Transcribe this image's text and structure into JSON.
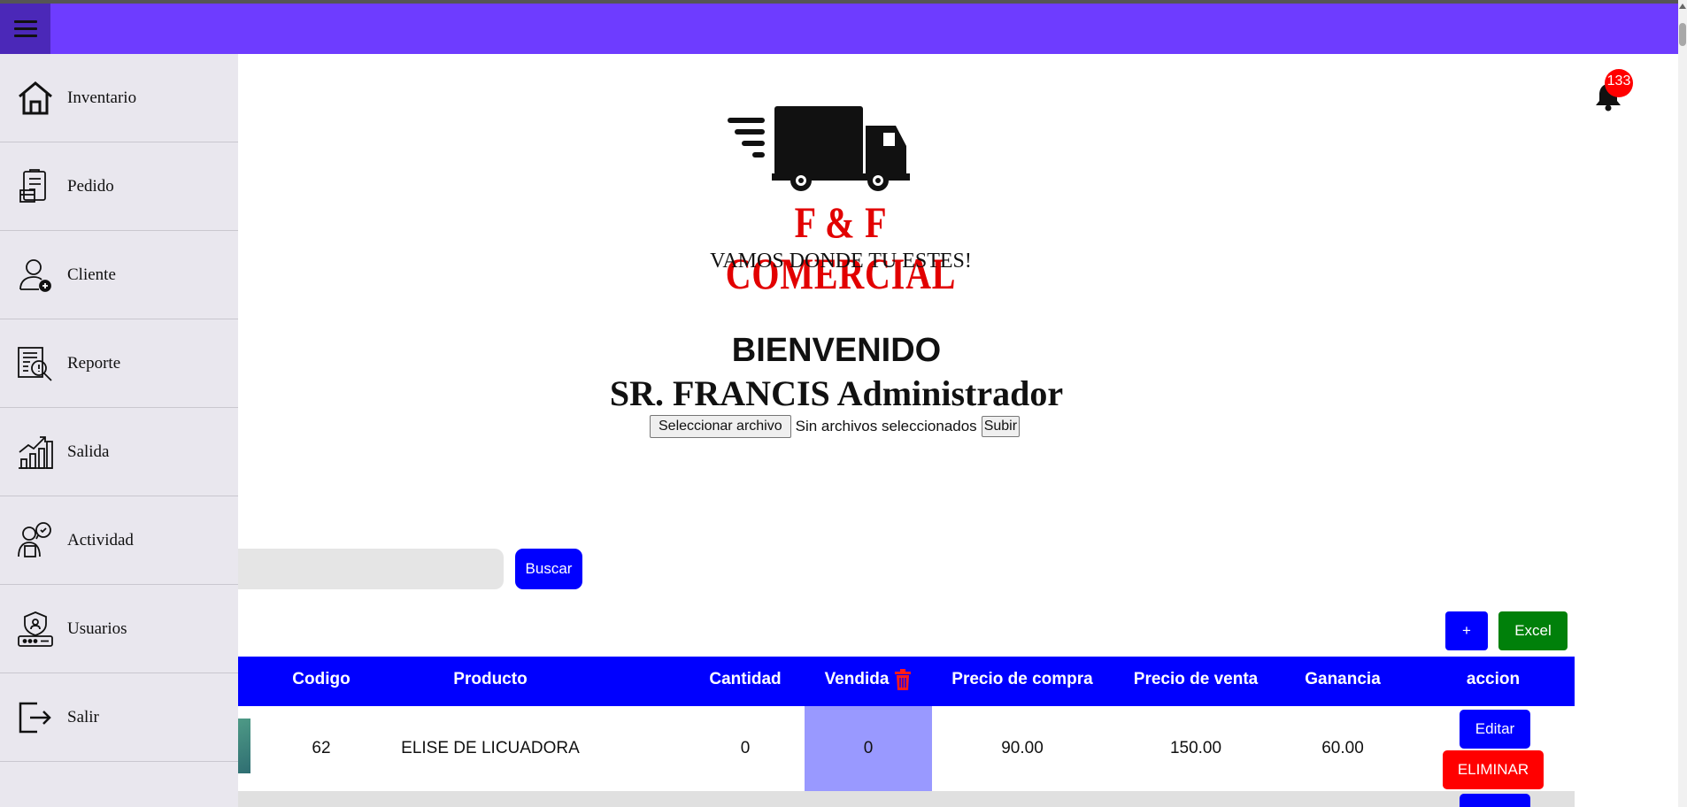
{
  "sidebar": {
    "items": [
      {
        "label": "Inventario",
        "icon": "home-icon"
      },
      {
        "label": "Pedido",
        "icon": "order-icon"
      },
      {
        "label": "Cliente",
        "icon": "add-user-icon"
      },
      {
        "label": "Reporte",
        "icon": "report-icon"
      },
      {
        "label": "Salida",
        "icon": "growth-chart-icon"
      },
      {
        "label": "Actividad",
        "icon": "activity-icon"
      },
      {
        "label": "Usuarios",
        "icon": "users-icon"
      },
      {
        "label": "Salir",
        "icon": "logout-icon"
      }
    ]
  },
  "logo": {
    "name": "F & F COMERCIAL",
    "tagline": "VAMOS DONDE TU ESTES!"
  },
  "notifications": {
    "count": "133"
  },
  "welcome": {
    "title": "BIENVENIDO",
    "user": "SR. FRANCIS Administrador"
  },
  "upload": {
    "choose_label": "Seleccionar archivo",
    "status": "Sin archivos seleccionados",
    "submit_label": "Subir"
  },
  "search": {
    "button_label": "Buscar"
  },
  "actions": {
    "add_label": "+",
    "excel_label": "Excel"
  },
  "table": {
    "headers": [
      "Codigo",
      "Producto",
      "Cantidad",
      "Vendida",
      "Precio de compra",
      "Precio de venta",
      "Ganancia",
      "accion"
    ],
    "rows": [
      {
        "codigo": "62",
        "producto": "ELISE DE LICUADORA",
        "cantidad": "0",
        "vendida": "0",
        "precio_compra": "90.00",
        "precio_venta": "150.00",
        "ganancia": "60.00",
        "edit_label": "Editar",
        "delete_label": "ELIMINAR"
      }
    ]
  },
  "colors": {
    "topbar": "#6e3cff",
    "primary": "#0000ff",
    "danger": "#ff0000",
    "excel": "#00800a",
    "sold_highlight": "#9999ff",
    "logo_red": "#e20000"
  }
}
